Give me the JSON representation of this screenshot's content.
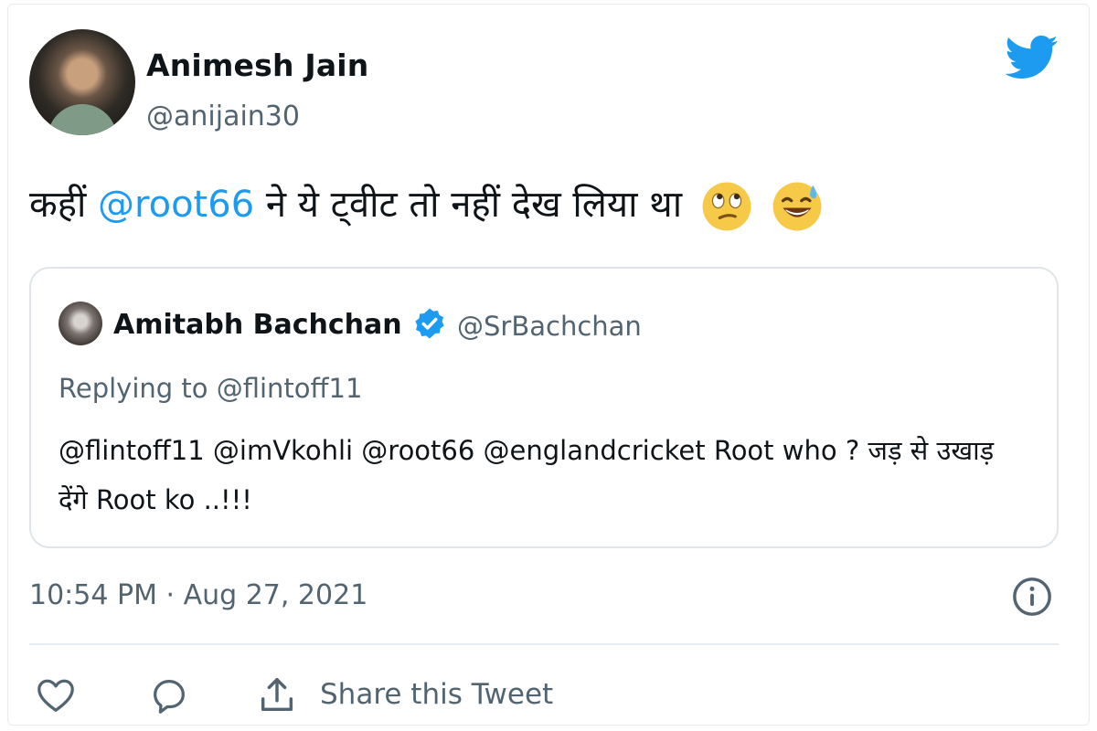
{
  "tweet": {
    "author": {
      "name": "Animesh Jain",
      "handle": "@anijain30"
    },
    "text": {
      "prefix": "कहीं ",
      "mention": "@root66",
      "suffix": "  ने ये ट्वीट तो नहीं देख लिया था"
    },
    "timestamp": "10:54 PM · Aug 27, 2021",
    "share_label": "Share this Tweet"
  },
  "quoted_tweet": {
    "author": {
      "name": "Amitabh Bachchan",
      "handle": "@SrBachchan"
    },
    "replying_to": "Replying to @flintoff11",
    "body": "@flintoff11 @imVkohli @root66 @englandcricket Root who ? जड़ से उखाड़ देंगे Root ko ..!!!"
  },
  "colors": {
    "accent": "#1d9bf0",
    "secondary_text": "#536471",
    "border": "#dfe5e9"
  },
  "icons": [
    "twitter-bird-icon",
    "rolling-eyes-emoji",
    "grinning-sweat-emoji",
    "verified-badge-icon",
    "info-icon",
    "heart-icon",
    "reply-icon",
    "share-icon"
  ]
}
